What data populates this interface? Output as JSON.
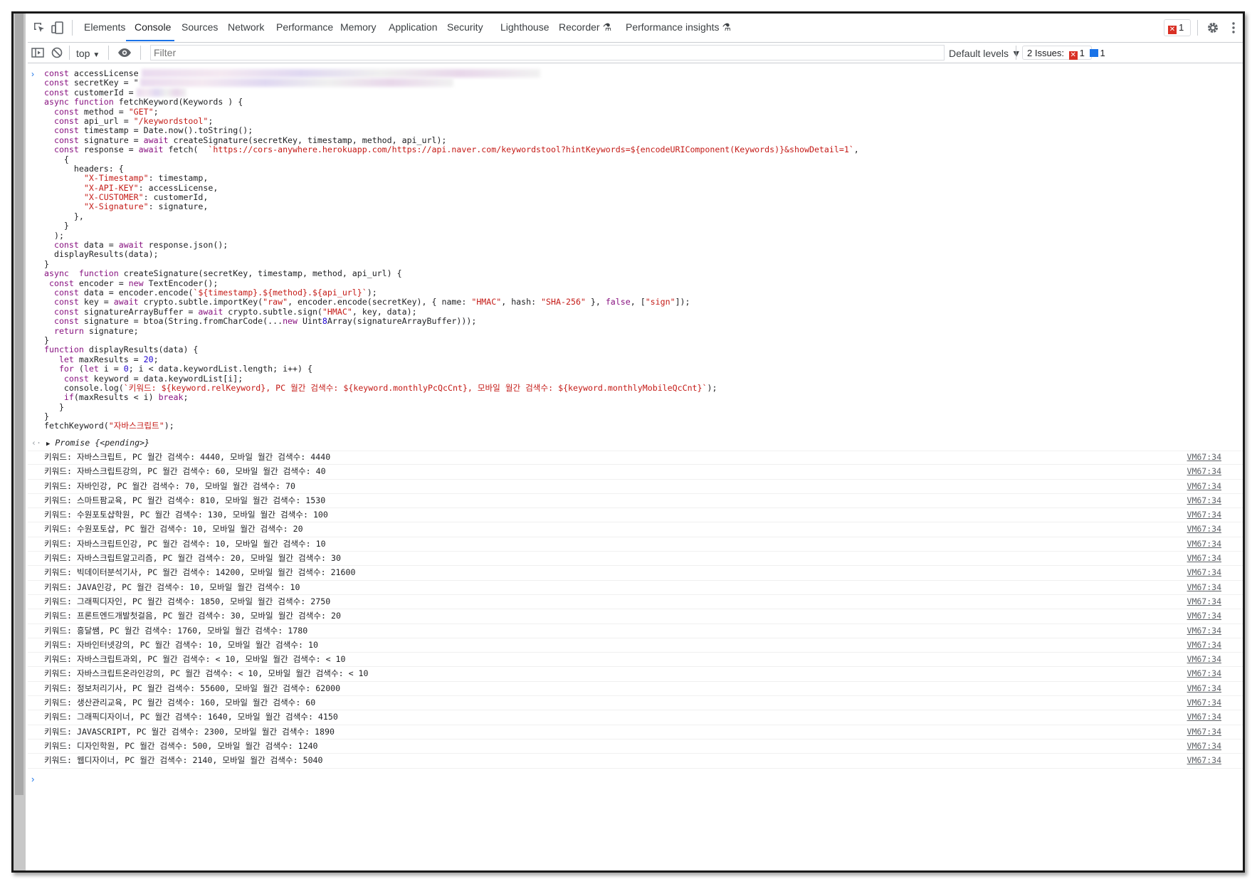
{
  "tabs": [
    "Elements",
    "Console",
    "Sources",
    "Network",
    "Performance",
    "Memory",
    "Application",
    "Security",
    "Lighthouse",
    "Recorder",
    "Performance insights"
  ],
  "active_tab": "Console",
  "error_count": "1",
  "toolbar": {
    "context": "top",
    "filter_placeholder": "Filter",
    "levels": "Default levels ▼",
    "issues_label": "2 Issues:",
    "issues_errors": "1",
    "issues_info": "1"
  },
  "icons": [
    "inspect-icon",
    "device-toggle-icon",
    "sidebar-toggle-icon",
    "clear-console-icon",
    "eye-icon",
    "gear-icon",
    "more-icon",
    "recorder-flask-icon",
    "insights-flask-icon"
  ],
  "code_lines": [
    "const accessLicense",
    "const secretKey = \"",
    "const customerId =",
    "async function fetchKeyword(Keywords ) {",
    "  const method = \"GET\";",
    "  const api_url = \"/keywordstool\";",
    "  const timestamp = Date.now().toString();",
    "  const signature = await createSignature(secretKey, timestamp, method, api_url);",
    "  const response = await fetch(  `https://cors-anywhere.herokuapp.com/https://api.naver.com/keywordstool?hintKeywords=${encodeURIComponent(Keywords)}&showDetail=1`,",
    "    {",
    "      headers: {",
    "        \"X-Timestamp\": timestamp,",
    "        \"X-API-KEY\": accessLicense,",
    "        \"X-CUSTOMER\": customerId,",
    "        \"X-Signature\": signature,",
    "      },",
    "    }",
    "  );",
    "  const data = await response.json();",
    "  displayResults(data);",
    "}",
    "async  function createSignature(secretKey, timestamp, method, api_url) {",
    " const encoder = new TextEncoder();",
    "  const data = encoder.encode(`${timestamp}.${method}.${api_url}`);",
    "  const key = await crypto.subtle.importKey(\"raw\", encoder.encode(secretKey), { name: \"HMAC\", hash: \"SHA-256\" }, false, [\"sign\"]);",
    "  const signatureArrayBuffer = await crypto.subtle.sign(\"HMAC\", key, data);",
    "  const signature = btoa(String.fromCharCode(...new Uint8Array(signatureArrayBuffer)));",
    "  return signature;",
    "}",
    "function displayResults(data) {",
    "   let maxResults = 20;",
    "   for (let i = 0; i < data.keywordList.length; i++) {",
    "    const keyword = data.keywordList[i];",
    "    console.log(`키워드: ${keyword.relKeyword}, PC 월간 검색수: ${keyword.monthlyPcQcCnt}, 모바일 월간 검색수: ${keyword.monthlyMobileQcCnt}`);",
    "    if(maxResults < i) break;",
    "   }",
    "}",
    "fetchKeyword(\"자바스크립트\");"
  ],
  "promise": "Promise {<pending>}",
  "log_source": "VM67:34",
  "logs": [
    "키워드: 자바스크립트, PC 월간 검색수: 4440, 모바일 월간 검색수: 4440",
    "키워드: 자바스크립트강의, PC 월간 검색수: 60, 모바일 월간 검색수: 40",
    "키워드: 자바인강, PC 월간 검색수: 70, 모바일 월간 검색수: 70",
    "키워드: 스마트팜교육, PC 월간 검색수: 810, 모바일 월간 검색수: 1530",
    "키워드: 수원포토샵학원, PC 월간 검색수: 130, 모바일 월간 검색수: 100",
    "키워드: 수원포토샵, PC 월간 검색수: 10, 모바일 월간 검색수: 20",
    "키워드: 자바스크립트인강, PC 월간 검색수: 10, 모바일 월간 검색수: 10",
    "키워드: 자바스크립트알고리즘, PC 월간 검색수: 20, 모바일 월간 검색수: 30",
    "키워드: 빅데이터분석기사, PC 월간 검색수: 14200, 모바일 월간 검색수: 21600",
    "키워드: JAVA인강, PC 월간 검색수: 10, 모바일 월간 검색수: 10",
    "키워드: 그래픽디자인, PC 월간 검색수: 1850, 모바일 월간 검색수: 2750",
    "키워드: 프론트엔드개발첫걸음, PC 월간 검색수: 30, 모바일 월간 검색수: 20",
    "키워드: 흥달쌤, PC 월간 검색수: 1760, 모바일 월간 검색수: 1780",
    "키워드: 자바인터넷강의, PC 월간 검색수: 10, 모바일 월간 검색수: 10",
    "키워드: 자바스크립트과외, PC 월간 검색수: < 10, 모바일 월간 검색수: < 10",
    "키워드: 자바스크립트온라인강의, PC 월간 검색수: < 10, 모바일 월간 검색수: < 10",
    "키워드: 정보처리기사, PC 월간 검색수: 55600, 모바일 월간 검색수: 62000",
    "키워드: 생산관리교육, PC 월간 검색수: 160, 모바일 월간 검색수: 60",
    "키워드: 그래픽디자이너, PC 월간 검색수: 1640, 모바일 월간 검색수: 4150",
    "키워드: JAVASCRIPT, PC 월간 검색수: 2300, 모바일 월간 검색수: 1890",
    "키워드: 디자인학원, PC 월간 검색수: 500, 모바일 월간 검색수: 1240",
    "키워드: 웹디자이너, PC 월간 검색수: 2140, 모바일 월간 검색수: 5040"
  ]
}
